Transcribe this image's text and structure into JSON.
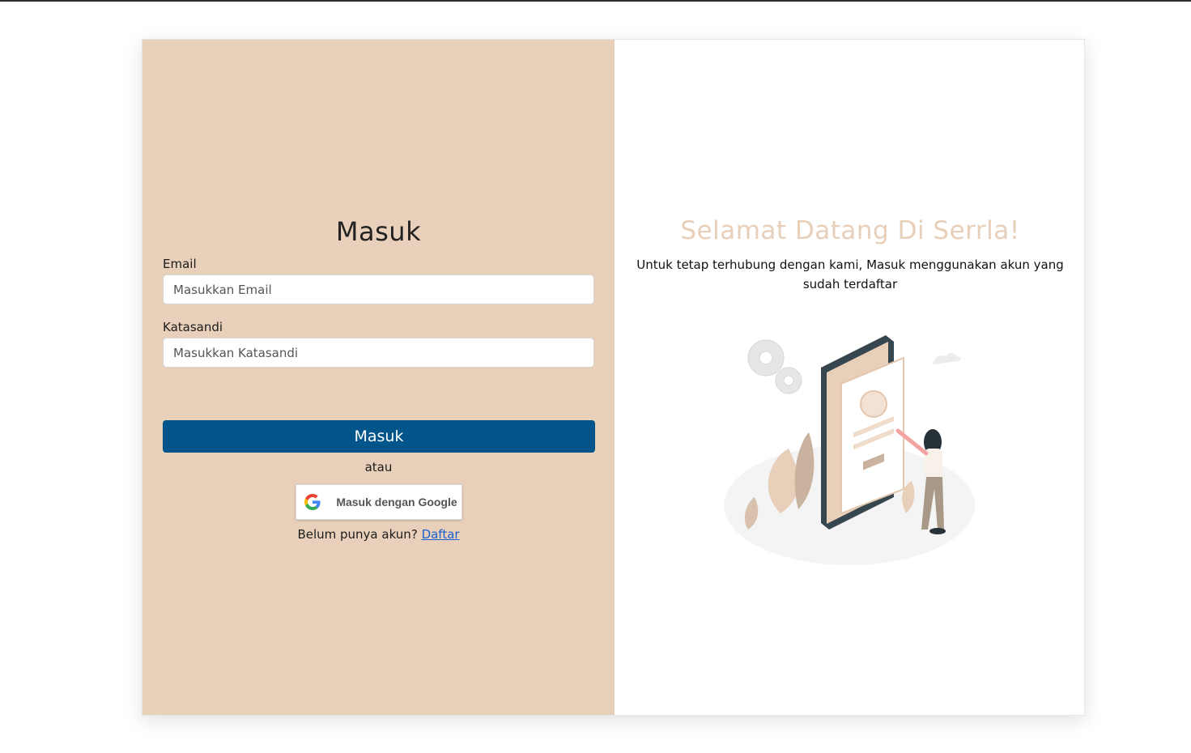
{
  "login": {
    "title": "Masuk",
    "email_label": "Email",
    "email_placeholder": "Masukkan Email",
    "password_label": "Katasandi",
    "password_placeholder": "Masukkan Katasandi",
    "submit_label": "Masuk",
    "divider_text": "atau",
    "google_label": "Masuk dengan Google",
    "signup_prompt": "Belum punya akun?",
    "signup_link": "Daftar"
  },
  "welcome": {
    "title": "Selamat Datang Di Serrla!",
    "text": "Untuk tetap terhubung dengan kami, Masuk menggunakan akun yang sudah terdaftar"
  },
  "colors": {
    "left_panel_bg": "#e8d0bb",
    "primary_button": "#02558a",
    "welcome_title": "#e8cfb9",
    "link": "#1a5fd0"
  },
  "icons": {
    "google": "google-g-icon",
    "illustration": "phone-login-illustration"
  }
}
